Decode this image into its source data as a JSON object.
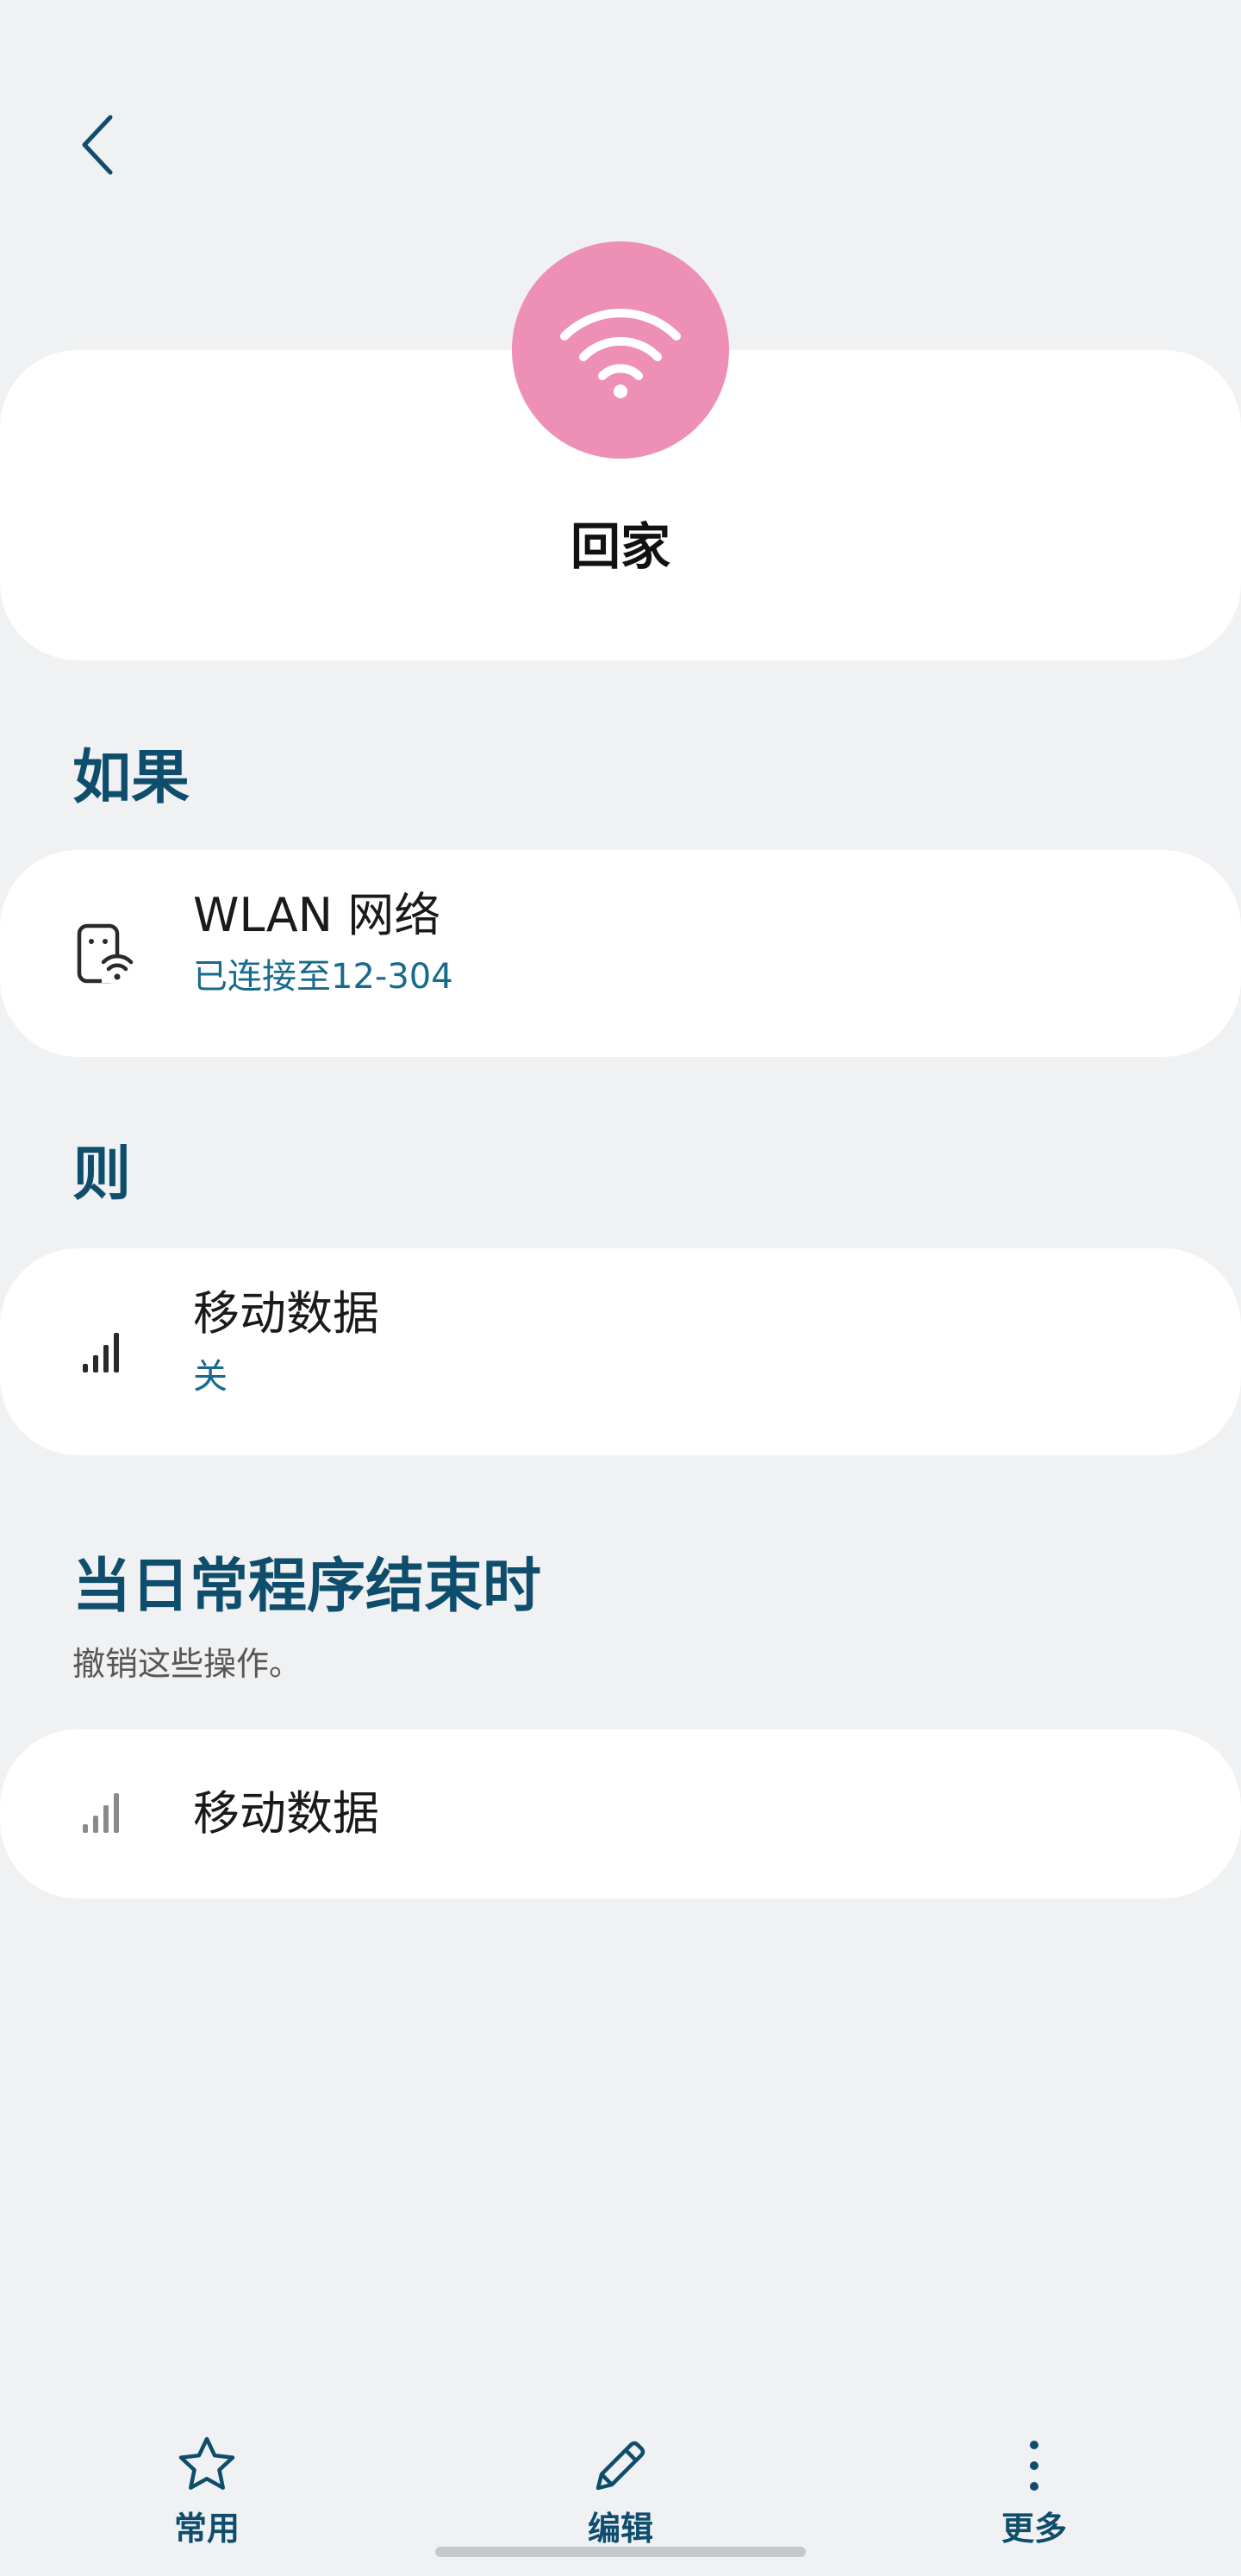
{
  "hero": {
    "title": "回家",
    "icon": "wifi-icon",
    "icon_bg_color": "#ee8fb6"
  },
  "if_section": {
    "heading": "如果",
    "card": {
      "icon": "phone-wifi-icon",
      "title": "WLAN 网络",
      "subtitle": "已连接至12-304"
    }
  },
  "then_section": {
    "heading": "则",
    "card": {
      "icon": "signal-bars-icon",
      "title": "移动数据",
      "subtitle": "关"
    }
  },
  "end_section": {
    "heading": "当日常程序结束时",
    "subtitle": "撤销这些操作。",
    "card": {
      "icon": "signal-bars-icon",
      "title": "移动数据"
    }
  },
  "bottom_nav": {
    "items": [
      {
        "label": "常用",
        "icon": "star-icon"
      },
      {
        "label": "编辑",
        "icon": "pencil-icon"
      },
      {
        "label": "更多",
        "icon": "more-vertical-icon"
      }
    ]
  },
  "colors": {
    "background": "#eff1f3",
    "accent": "#0e4d6b",
    "link": "#17698d"
  }
}
